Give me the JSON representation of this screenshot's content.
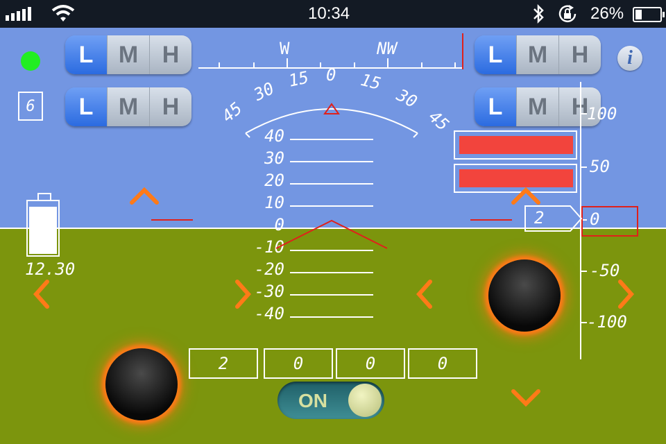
{
  "status_bar": {
    "time": "10:34",
    "battery_percent_label": "26%",
    "battery_level": 0.26
  },
  "mode_switches": [
    {
      "id": "left-top",
      "options": [
        "L",
        "M",
        "H"
      ],
      "selected": "L"
    },
    {
      "id": "left-bottom",
      "options": [
        "L",
        "M",
        "H"
      ],
      "selected": "L"
    },
    {
      "id": "right-top",
      "options": [
        "L",
        "M",
        "H"
      ],
      "selected": "L"
    },
    {
      "id": "right-bottom",
      "options": [
        "L",
        "M",
        "H"
      ],
      "selected": "L"
    }
  ],
  "gps_satellites": "6",
  "compass": {
    "labels": [
      "W",
      "NW"
    ]
  },
  "roll_scale": {
    "labels": [
      "45",
      "30",
      "15",
      "0",
      "15",
      "30",
      "45"
    ]
  },
  "pitch_ladder": [
    "40",
    "30",
    "20",
    "10",
    "0",
    "-10",
    "-20",
    "-30",
    "-40"
  ],
  "altitude": {
    "scale": [
      "100",
      "50",
      "0",
      "-50",
      "-100"
    ],
    "current_altitude": "2",
    "highlighted_value": "0"
  },
  "battery_voltage": "12.30",
  "channel_values": [
    "2",
    "0",
    "0",
    "0"
  ],
  "toggle": {
    "label": "ON",
    "state": true
  },
  "colors": {
    "sky": "#7396e2",
    "ground": "#7c950d",
    "accent_orange": "#ff7a18",
    "alert_red": "#f2443d",
    "status_green": "#22ee22"
  },
  "icons": [
    "signal-bars-icon",
    "wifi-icon",
    "bluetooth-icon",
    "rotation-lock-icon",
    "battery-icon",
    "info-icon",
    "battery-level-icon"
  ]
}
